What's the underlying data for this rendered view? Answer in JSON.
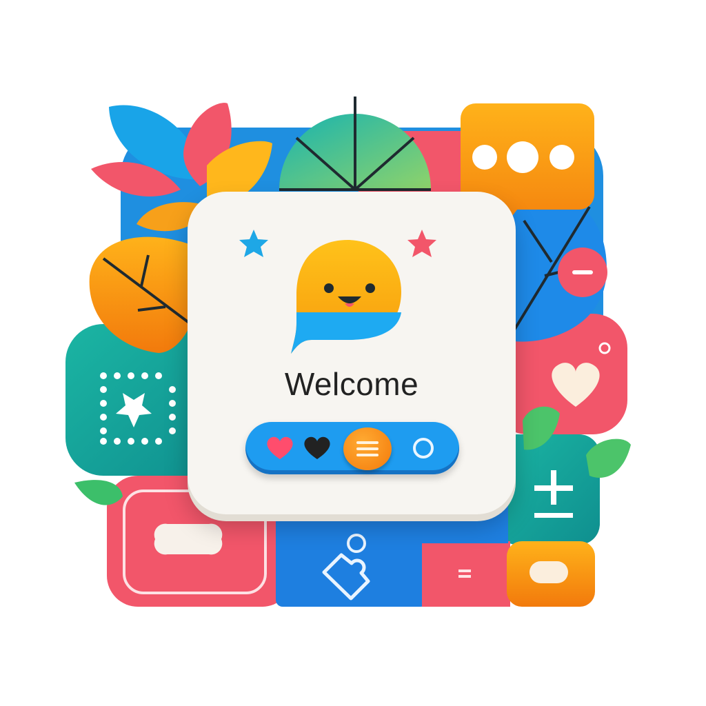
{
  "card": {
    "title": "Welcome"
  },
  "toolbar": {
    "buttons": [
      {
        "icon": "heart-red-icon",
        "color": "#ff4d6d"
      },
      {
        "icon": "heart-black-icon",
        "color": "#222222"
      },
      {
        "icon": "menu-icon",
        "color": "#f7890f"
      },
      {
        "icon": "circle-icon",
        "color": "#0a5ea8"
      }
    ]
  },
  "palette": {
    "blue": "#1e9cf0",
    "red": "#f2566a",
    "orange": "#f7890f",
    "yellow": "#ffc21a",
    "teal": "#1fb0a0",
    "green": "#4fc06a",
    "card": "#f7f5f1"
  }
}
